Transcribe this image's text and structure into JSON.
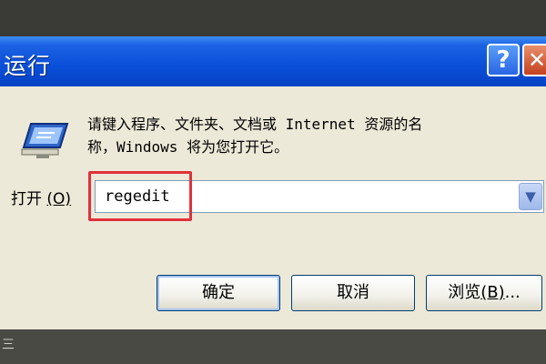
{
  "window": {
    "title": "运行",
    "help_label": "?",
    "close_label": "✕"
  },
  "icon": {
    "name": "run-icon"
  },
  "description": {
    "line1": "请键入程序、文件夹、文档或 Internet 资源的名",
    "line2": "称，Windows 将为您打开它。"
  },
  "open_field": {
    "label": "打开",
    "hotkey": "(O)",
    "value": "regedit",
    "dropdown_glyph": "▼"
  },
  "buttons": {
    "ok_label": "确定",
    "cancel_label": "取消",
    "browse_label": "浏览",
    "browse_hotkey": "(B)",
    "browse_suffix": "..."
  },
  "background": {
    "corner_mark": "三"
  },
  "colors": {
    "titlebar": "#0a4fd8",
    "dialog_bg": "#ece9d8",
    "highlight": "#e0323a"
  }
}
